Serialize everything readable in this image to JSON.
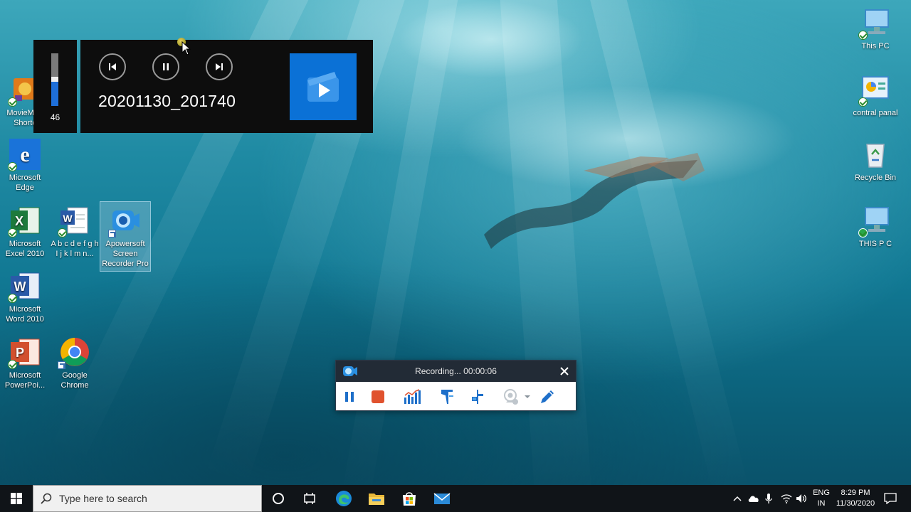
{
  "desktop": {
    "left_icons": [
      {
        "label": "MovieMa - Shortc",
        "icon": "moviemaker-icon"
      },
      {
        "label": "Microsoft Edge",
        "icon": "edge-icon"
      },
      {
        "label": "Microsoft Excel 2010",
        "icon": "excel-icon"
      },
      {
        "label": "A b c d e f g h I j k l m n...",
        "icon": "word-document-icon"
      },
      {
        "label": "Apowersoft Screen Recorder Pro",
        "icon": "apowersoft-recorder-icon"
      },
      {
        "label": "Microsoft Word 2010",
        "icon": "word-icon"
      },
      {
        "label": "Microsoft PowerPoi...",
        "icon": "powerpoint-icon"
      },
      {
        "label": "Google Chrome",
        "icon": "chrome-icon"
      }
    ],
    "right_icons": [
      {
        "label": "This PC",
        "icon": "computer-icon"
      },
      {
        "label": "contral panal",
        "icon": "control-panel-icon"
      },
      {
        "label": "Recycle Bin",
        "icon": "recycle-bin-icon"
      },
      {
        "label": "THIS P C",
        "icon": "computer-icon"
      }
    ]
  },
  "media_overlay": {
    "volume": 46,
    "volume_label": "46",
    "title": "20201130_201740",
    "buttons": [
      "previous-track",
      "pause",
      "next-track"
    ],
    "accent": "#0b71d6"
  },
  "recorder": {
    "status": "Recording... 00:00:06",
    "tools": [
      "pause",
      "stop",
      "audio-levels",
      "pin",
      "pin-alt",
      "webcam",
      "webcam-dropdown",
      "pen"
    ],
    "stop_color": "#e0522e",
    "accent": "#1e6fc9"
  },
  "taskbar": {
    "search_placeholder": "Type here to search",
    "apps": [
      "cortana",
      "task-view",
      "edge",
      "file-explorer",
      "store",
      "mail"
    ],
    "tray": {
      "lang_line1": "ENG",
      "lang_line2": "IN",
      "time": "8:29 PM",
      "date": "11/30/2020"
    }
  }
}
